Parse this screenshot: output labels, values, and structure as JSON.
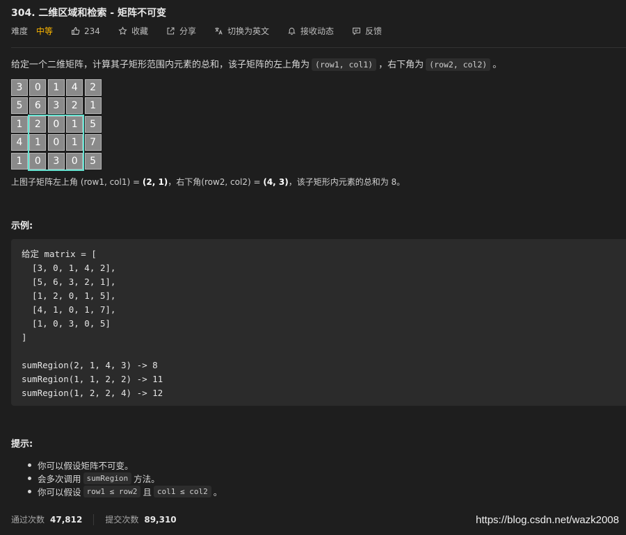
{
  "problem": {
    "title": "304. 二维区域和检索 - 矩阵不可变"
  },
  "meta": {
    "difficulty_label": "难度",
    "difficulty_value": "中等",
    "likes": "234",
    "favorite_label": "收藏",
    "share_label": "分享",
    "translate_label": "切换为英文",
    "notify_label": "接收动态",
    "feedback_label": "反馈",
    "colors": {
      "difficulty": "#ffb800",
      "highlight": "#66e3d2"
    }
  },
  "description": {
    "text_1": "给定一个二维矩阵，计算其子矩形范围内元素的总和，该子矩阵的左上角为",
    "code_1": "(row1, col1)",
    "text_2": "，右下角为",
    "code_2": "(row2, col2)",
    "text_3": "。"
  },
  "matrix": [
    [
      3,
      0,
      1,
      4,
      2
    ],
    [
      5,
      6,
      3,
      2,
      1
    ],
    [
      1,
      2,
      0,
      1,
      5
    ],
    [
      4,
      1,
      0,
      1,
      7
    ],
    [
      1,
      0,
      3,
      0,
      5
    ]
  ],
  "highlight": {
    "row1": 2,
    "col1": 1,
    "row2": 4,
    "col2": 3
  },
  "caption": {
    "part_1": "上图子矩阵左上角 (row1, col1) = ",
    "b_1": "(2, 1)",
    "part_2": "，右下角(row2, col2) = ",
    "b_2": "(4, 3)",
    "part_3": "，该子矩形内元素的总和为 8。"
  },
  "example": {
    "heading": "示例:",
    "lines": [
      "给定 matrix = [",
      "  [3, 0, 1, 4, 2],",
      "  [5, 6, 3, 2, 1],",
      "  [1, 2, 0, 1, 5],",
      "  [4, 1, 0, 1, 7],",
      "  [1, 0, 3, 0, 5]",
      "]",
      "",
      "sumRegion(2, 1, 4, 3) -> 8",
      "sumRegion(1, 1, 2, 2) -> 11",
      "sumRegion(1, 2, 2, 4) -> 12"
    ]
  },
  "hints": {
    "heading": "提示:",
    "h1": "你可以假设矩阵不可变。",
    "h2_pre": "会多次调用",
    "h2_code": "sumRegion",
    "h2_post": "方法。",
    "h3_pre": "你可以假设",
    "h3_code1": "row1 ≤ row2",
    "h3_mid": "且",
    "h3_code2": "col1 ≤ col2",
    "h3_post": "。"
  },
  "stats": {
    "accepted_label": "通过次数",
    "accepted_value": "47,812",
    "submissions_label": "提交次数",
    "submissions_value": "89,310"
  },
  "watermark": "https://blog.csdn.net/wazk2008"
}
